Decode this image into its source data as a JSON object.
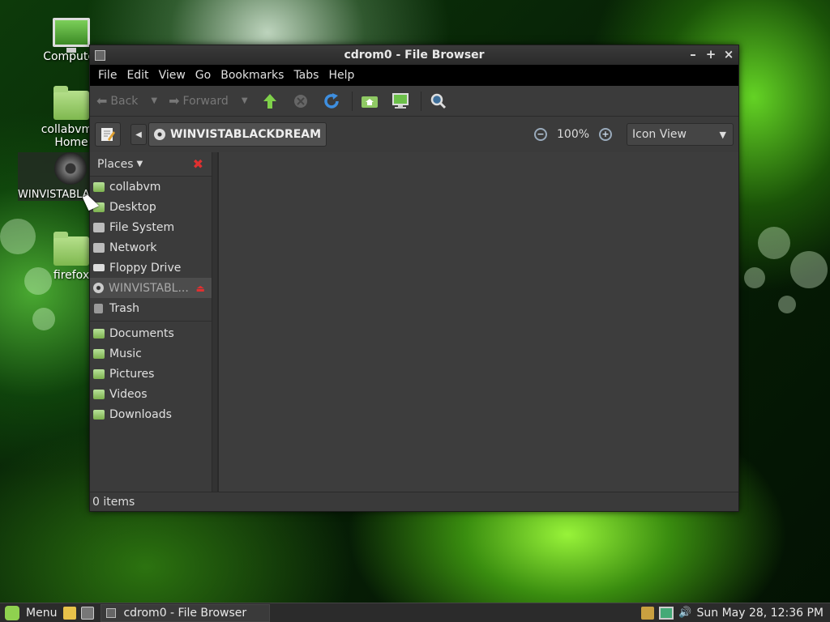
{
  "desktop": {
    "icons": [
      {
        "label": "Computer"
      },
      {
        "label": "collabvm's Home"
      },
      {
        "label": "WINVISTABLACKDREAM"
      },
      {
        "label": "firefox"
      }
    ]
  },
  "window": {
    "title": "cdrom0 - File Browser",
    "controls": {
      "minimize": "–",
      "maximize": "+",
      "close": "×"
    }
  },
  "menubar": {
    "items": [
      "File",
      "Edit",
      "View",
      "Go",
      "Bookmarks",
      "Tabs",
      "Help"
    ]
  },
  "toolbar": {
    "back_label": "Back",
    "forward_label": "Forward"
  },
  "locationbar": {
    "crumb": "WINVISTABLACKDREAM",
    "zoom": "100%",
    "view_mode": "Icon View"
  },
  "sidebar": {
    "header": "Places",
    "items": [
      {
        "label": "collabvm",
        "icon": "home-folder-icon"
      },
      {
        "label": "Desktop",
        "icon": "desktop-folder-icon"
      },
      {
        "label": "File System",
        "icon": "drive-icon"
      },
      {
        "label": "Network",
        "icon": "network-icon"
      },
      {
        "label": "Floppy Drive",
        "icon": "floppy-icon"
      },
      {
        "label": "WINVISTABL...",
        "icon": "disc-icon",
        "selected": true
      },
      {
        "label": "Trash",
        "icon": "trash-icon"
      }
    ],
    "bookmarks": [
      {
        "label": "Documents"
      },
      {
        "label": "Music"
      },
      {
        "label": "Pictures"
      },
      {
        "label": "Videos"
      },
      {
        "label": "Downloads"
      }
    ]
  },
  "statusbar": {
    "text": "0 items"
  },
  "taskbar": {
    "menu_label": "Menu",
    "task_label": "cdrom0 - File Browser",
    "clock": "Sun May 28, 12:36 PM"
  },
  "colors": {
    "accent": "#8fd14f",
    "eject": "#e03030"
  }
}
